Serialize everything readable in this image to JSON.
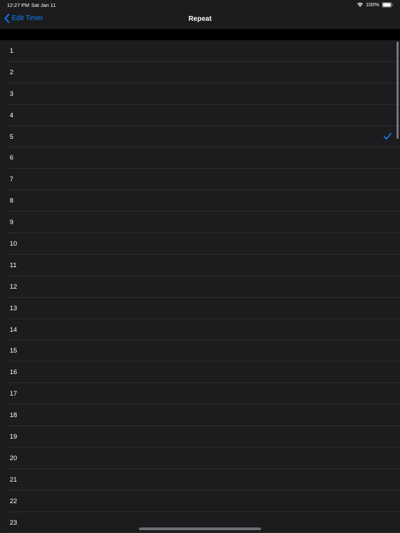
{
  "status_bar": {
    "time": "12:27 PM",
    "date": "Sat Jan 11",
    "battery": "100%",
    "wifi_icon": "wifi-icon",
    "battery_icon": "battery-icon"
  },
  "nav": {
    "back_label": "Edit Timer",
    "back_icon": "chevron-left-icon",
    "title": "Repeat"
  },
  "colors": {
    "accent": "#0a84ff",
    "background": "#000000",
    "row_background": "#1c1c1e",
    "separator": "#2c2c2e"
  },
  "list": {
    "selected_value": "5",
    "check_icon": "checkmark-icon",
    "items": [
      {
        "label": "1"
      },
      {
        "label": "2"
      },
      {
        "label": "3"
      },
      {
        "label": "4"
      },
      {
        "label": "5"
      },
      {
        "label": "6"
      },
      {
        "label": "7"
      },
      {
        "label": "8"
      },
      {
        "label": "9"
      },
      {
        "label": "10"
      },
      {
        "label": "11"
      },
      {
        "label": "12"
      },
      {
        "label": "13"
      },
      {
        "label": "14"
      },
      {
        "label": "15"
      },
      {
        "label": "16"
      },
      {
        "label": "17"
      },
      {
        "label": "18"
      },
      {
        "label": "19"
      },
      {
        "label": "20"
      },
      {
        "label": "21"
      },
      {
        "label": "22"
      },
      {
        "label": "23"
      }
    ]
  }
}
